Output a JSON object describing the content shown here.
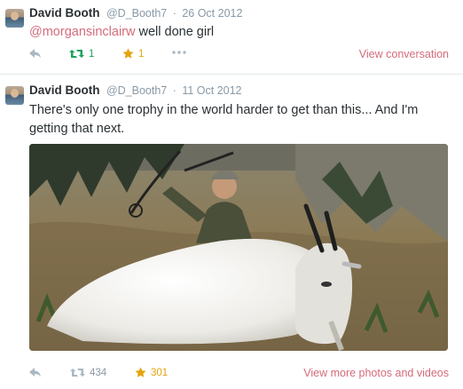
{
  "tweets": [
    {
      "fullname": "David Booth",
      "username": "@D_Booth7",
      "separator": "·",
      "date": "26 Oct 2012",
      "mention": "@morgansinclairw",
      "text": " well done girl",
      "retweets": "1",
      "favorites": "1",
      "link": "View conversation"
    },
    {
      "fullname": "David Booth",
      "username": "@D_Booth7",
      "separator": "·",
      "date": "11 Oct 2012",
      "text": "There's only one trophy in the world harder to get than this... And I'm getting that next.",
      "retweets": "434",
      "favorites": "301",
      "link": "View more photos and videos"
    }
  ],
  "colors": {
    "link": "#d46b7a",
    "muted": "#8899a6",
    "retweet_active": "#19a35c",
    "favorite": "#e3a40c"
  },
  "icons": [
    "reply-icon",
    "retweet-icon",
    "favorite-star-icon",
    "more-dots-icon"
  ]
}
